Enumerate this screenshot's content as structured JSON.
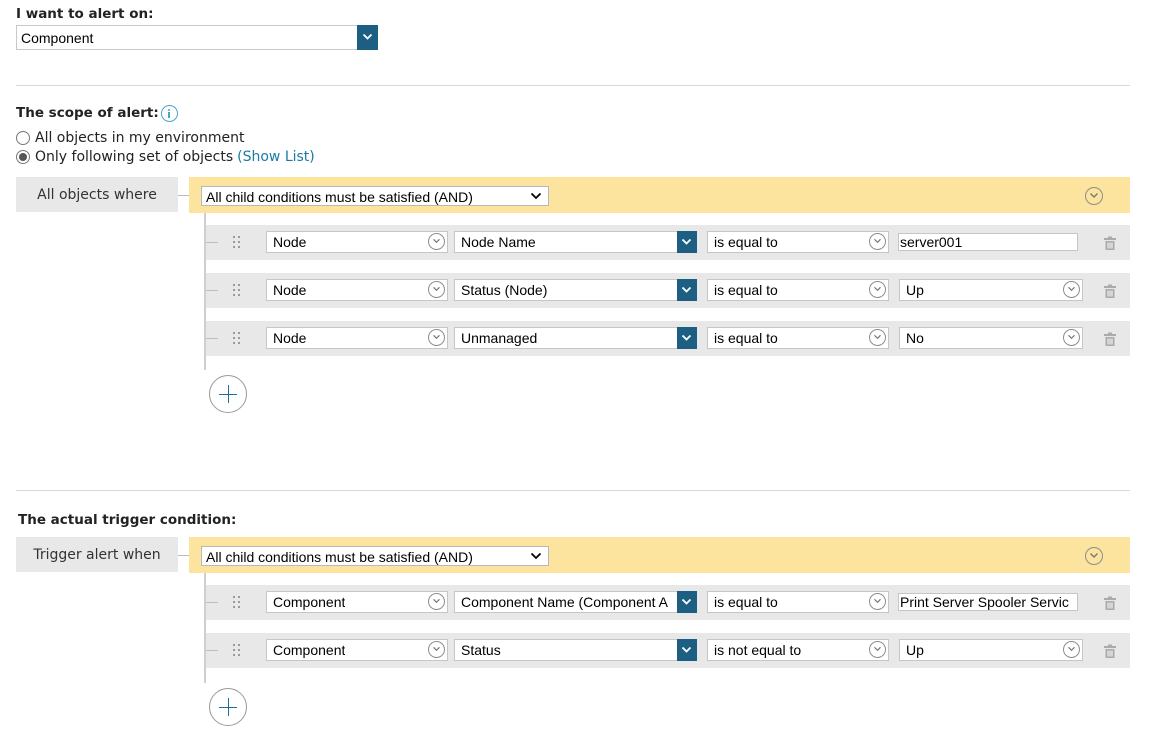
{
  "alert_on": {
    "label": "I want to alert on:",
    "value": "Component"
  },
  "scope": {
    "label": "The scope of alert:",
    "options": [
      "All objects in my environment",
      "Only following set of objects"
    ],
    "selected_index": 1,
    "show_list_link": "(Show List)",
    "group_label": "All objects where",
    "group_operator": "All child conditions must be satisfied (AND)",
    "conditions": [
      {
        "object": "Node",
        "property": "Node Name",
        "operator": "is equal to",
        "value": "server001",
        "value_type": "text"
      },
      {
        "object": "Node",
        "property": "Status (Node)",
        "operator": "is equal to",
        "value": "Up",
        "value_type": "select"
      },
      {
        "object": "Node",
        "property": "Unmanaged",
        "operator": "is equal to",
        "value": "No",
        "value_type": "select"
      }
    ]
  },
  "trigger": {
    "label": "The actual trigger condition:",
    "group_label": "Trigger alert when",
    "group_operator": "All child conditions must be satisfied (AND)",
    "conditions": [
      {
        "object": "Component",
        "property": "Component Name (Component A",
        "operator": "is equal to",
        "value": "Print Server Spooler Servic",
        "value_type": "text"
      },
      {
        "object": "Component",
        "property": "Status",
        "operator": "is not equal to",
        "value": "Up",
        "value_type": "select"
      }
    ]
  },
  "colors": {
    "accent_blue": "#1d5f83",
    "and_bar": "#fce39e",
    "link": "#1b7ba6"
  },
  "icons": [
    "info-icon",
    "chevron-down-icon",
    "drag-handle-icon",
    "trash-icon",
    "add-icon"
  ]
}
